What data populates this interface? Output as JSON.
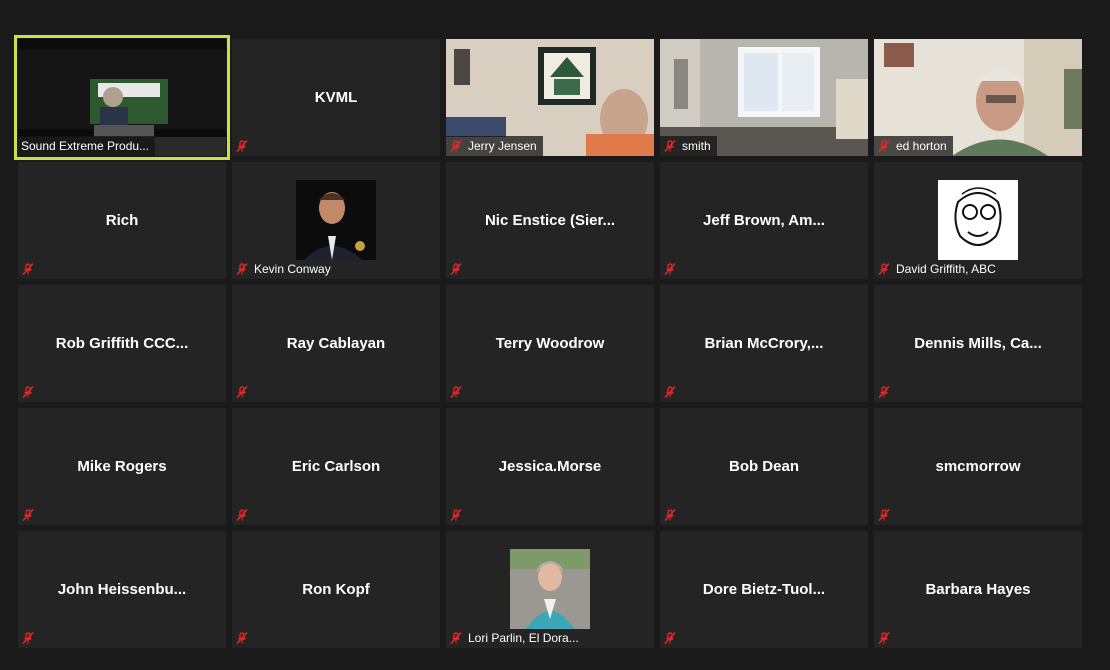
{
  "participants": [
    {
      "name": "Sound Extreme Produ...",
      "video": true,
      "active": true
    },
    {
      "name": "KVML",
      "video": false
    },
    {
      "name": "Jerry Jensen",
      "video": true
    },
    {
      "name": "smith",
      "video": true
    },
    {
      "name": "ed horton",
      "video": true
    },
    {
      "name": "Rich",
      "video": false
    },
    {
      "name": "Kevin Conway",
      "avatar": true
    },
    {
      "name": "Nic Enstice (Sier...",
      "video": false
    },
    {
      "name": "Jeff Brown, Am...",
      "video": false
    },
    {
      "name": "David Griffith, ABC",
      "avatar": true
    },
    {
      "name": "Rob Griffith CCC...",
      "video": false
    },
    {
      "name": "Ray Cablayan",
      "video": false
    },
    {
      "name": "Terry Woodrow",
      "video": false
    },
    {
      "name": "Brian McCrory,...",
      "video": false
    },
    {
      "name": "Dennis Mills, Ca...",
      "video": false
    },
    {
      "name": "Mike Rogers",
      "video": false
    },
    {
      "name": "Eric Carlson",
      "video": false
    },
    {
      "name": "Jessica.Morse",
      "video": false
    },
    {
      "name": "Bob Dean",
      "video": false
    },
    {
      "name": "smcmorrow",
      "video": false
    },
    {
      "name": "John Heissenbu...",
      "video": false
    },
    {
      "name": "Ron Kopf",
      "video": false
    },
    {
      "name": "Lori Parlin, El Dora...",
      "avatar": true
    },
    {
      "name": "Dore Bietz-Tuol...",
      "video": false
    },
    {
      "name": "Barbara Hayes",
      "video": false
    }
  ],
  "colors": {
    "active_border": "#c6e14a",
    "mute": "#e02828",
    "tile": "#242424"
  },
  "icons": {
    "mute": "microphone-muted-icon"
  }
}
